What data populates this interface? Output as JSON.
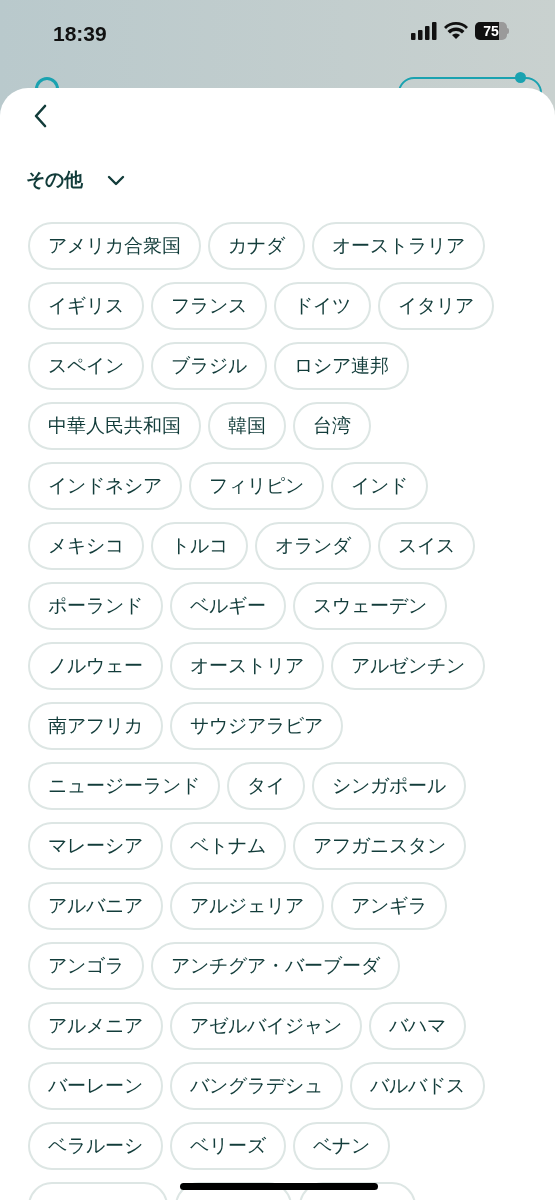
{
  "status_bar": {
    "time": "18:39",
    "battery": "75"
  },
  "section": {
    "title": "その他",
    "expanded": true
  },
  "countries": [
    "アメリカ合衆国",
    "カナダ",
    "オーストラリア",
    "イギリス",
    "フランス",
    "ドイツ",
    "イタリア",
    "スペイン",
    "ブラジル",
    "ロシア連邦",
    "中華人民共和国",
    "韓国",
    "台湾",
    "インドネシア",
    "フィリピン",
    "インド",
    "メキシコ",
    "トルコ",
    "オランダ",
    "スイス",
    "ポーランド",
    "ベルギー",
    "スウェーデン",
    "ノルウェー",
    "オーストリア",
    "アルゼンチン",
    "南アフリカ",
    "サウジアラビア",
    "ニュージーランド",
    "タイ",
    "シンガポール",
    "マレーシア",
    "ベトナム",
    "アフガニスタン",
    "アルバニア",
    "アルジェリア",
    "アンギラ",
    "アンゴラ",
    "アンチグア・バーブーダ",
    "アルメニア",
    "アゼルバイジャン",
    "バハマ",
    "バーレーン",
    "バングラデシュ",
    "バルバドス",
    "ベラルーシ",
    "ベリーズ",
    "ベナン"
  ]
}
